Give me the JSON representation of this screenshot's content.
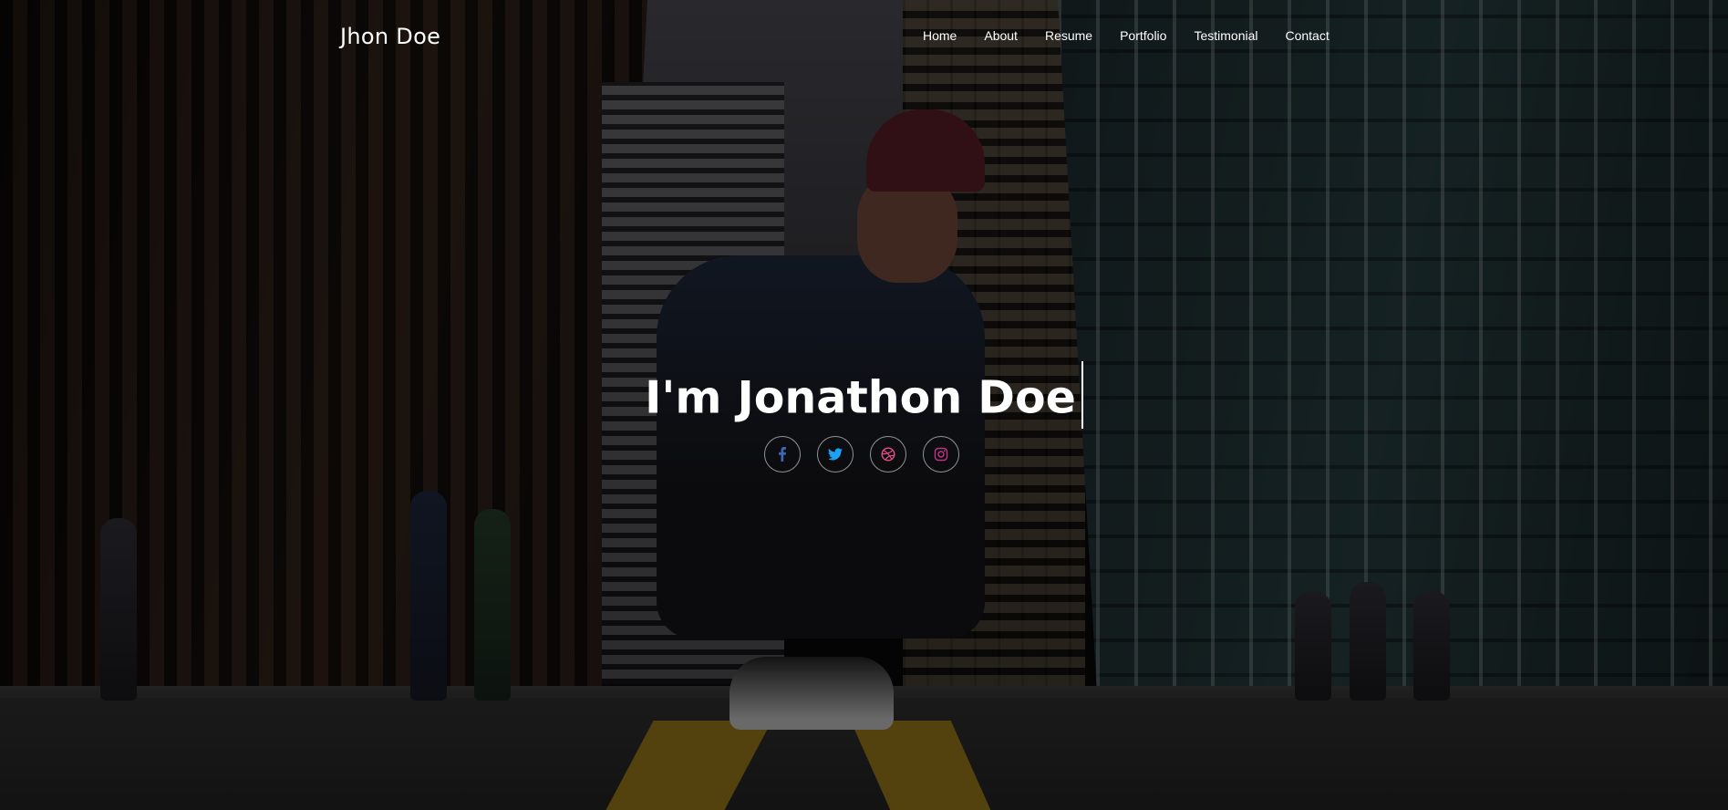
{
  "header": {
    "brand": "Jhon Doe",
    "nav": [
      "Home",
      "About",
      "Resume",
      "Portfolio",
      "Testimonial",
      "Contact"
    ]
  },
  "hero": {
    "headline": "I'm Jonathon Doe"
  },
  "social": {
    "facebook": {
      "icon": "facebook-icon",
      "color": "#4267b2"
    },
    "twitter": {
      "icon": "twitter-icon",
      "color": "#1da1f2"
    },
    "dribbble": {
      "icon": "dribbble-icon",
      "color": "#ea4c89"
    },
    "instagram": {
      "icon": "instagram-icon",
      "color": "#c13584"
    }
  }
}
